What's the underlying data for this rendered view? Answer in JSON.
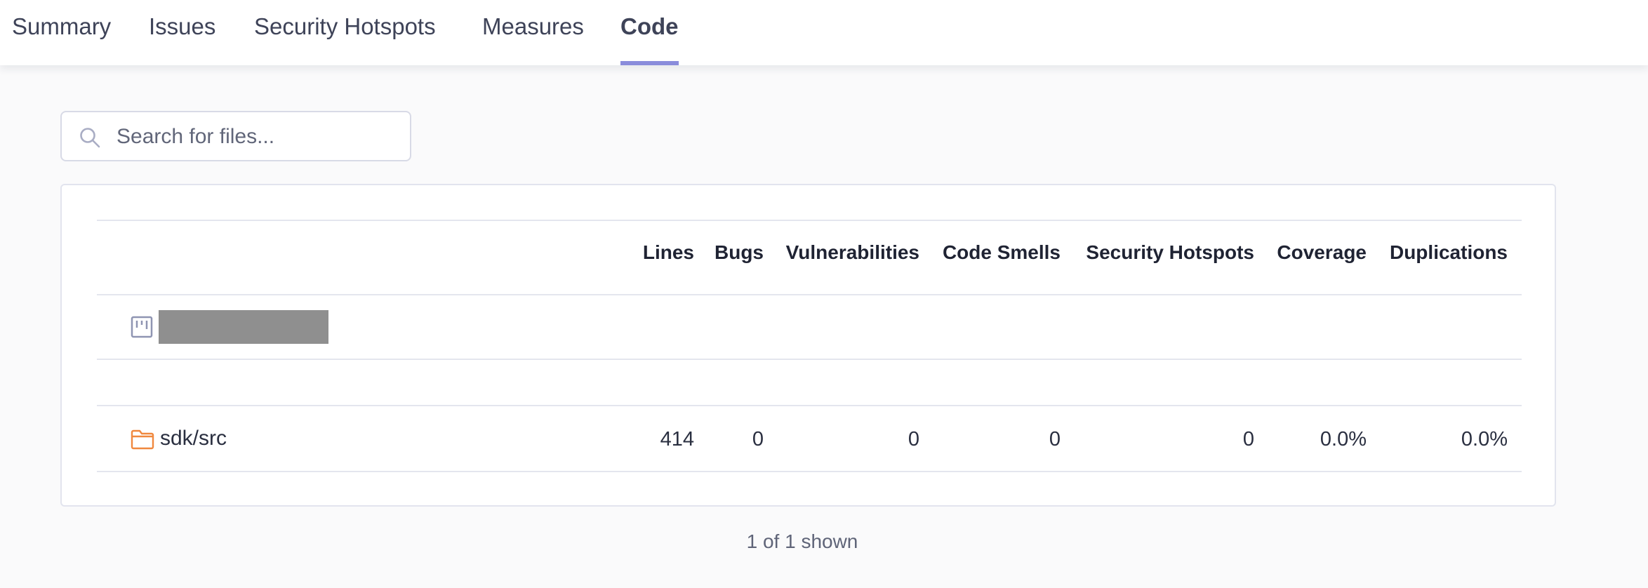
{
  "nav": {
    "tabs": [
      {
        "label": "Summary",
        "active": false
      },
      {
        "label": "Issues",
        "active": false
      },
      {
        "label": "Security Hotspots",
        "active": false
      },
      {
        "label": "Measures",
        "active": false
      },
      {
        "label": "Code",
        "active": true
      }
    ]
  },
  "search": {
    "placeholder": "Search for files...",
    "icon": "search-icon"
  },
  "table": {
    "columns": [
      "Lines",
      "Bugs",
      "Vulnerabilities",
      "Code Smells",
      "Security Hotspots",
      "Coverage",
      "Duplications"
    ],
    "project_row": {
      "icon": "project-icon"
    },
    "rows": [
      {
        "icon": "folder-icon",
        "name": "sdk/src",
        "lines": "414",
        "bugs": "0",
        "vulnerabilities": "0",
        "code_smells": "0",
        "security_hotspots": "0",
        "coverage": "0.0%",
        "duplications": "0.0%"
      }
    ]
  },
  "footer": {
    "shown": "1 of 1 shown"
  },
  "colors": {
    "accent": "#8a8cdb",
    "folder": "#f0883e"
  }
}
